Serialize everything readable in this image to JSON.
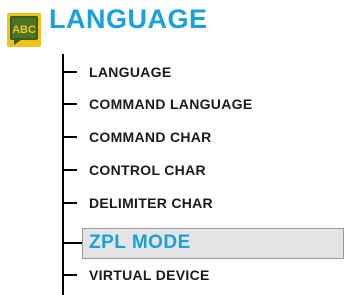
{
  "header": {
    "icon": "abc-language-icon",
    "icon_text": "ABC",
    "title": "LANGUAGE",
    "title_color": "#1aa0da"
  },
  "menu": {
    "items": [
      {
        "label": "LANGUAGE",
        "selected": false
      },
      {
        "label": "COMMAND LANGUAGE",
        "selected": false
      },
      {
        "label": "COMMAND CHAR",
        "selected": false
      },
      {
        "label": "CONTROL CHAR",
        "selected": false
      },
      {
        "label": "DELIMITER CHAR",
        "selected": false
      },
      {
        "label": "ZPL MODE",
        "selected": true
      },
      {
        "label": "VIRTUAL DEVICE",
        "selected": false
      }
    ]
  },
  "colors": {
    "accent": "#1aa0da",
    "icon_yellow": "#f2c21a",
    "icon_green": "#3a5a1e",
    "highlight_bg": "#e4e4e4"
  }
}
